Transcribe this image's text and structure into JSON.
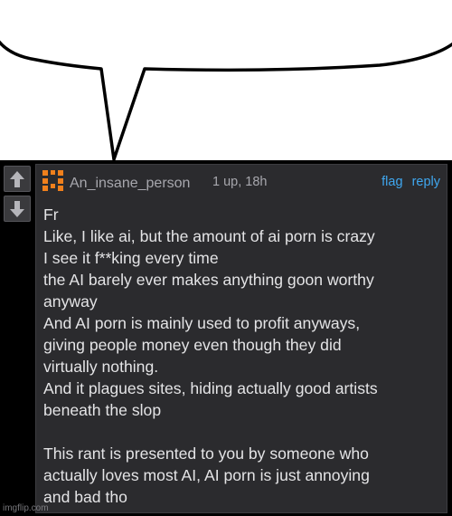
{
  "comment": {
    "username": "An_insane_person",
    "meta": "1 up, 18h",
    "actions": {
      "flag": "flag",
      "reply": "reply"
    },
    "lines": [
      "Fr",
      "Like, I like ai, but the amount of ai porn is crazy",
      "I see it f**king every time",
      "the AI barely ever makes anything goon worthy",
      "anyway",
      "And AI porn is mainly used to profit anyways,",
      "giving people money even though they did",
      "virtually nothing.",
      "And it plagues sites, hiding actually good artists",
      "beneath the slop",
      "",
      "This rant is presented to you by someone who",
      "actually loves most AI, AI porn is just annoying",
      "and bad tho"
    ]
  },
  "watermark": "imgflip.com",
  "colors": {
    "link": "#3fa7ef",
    "avatar": "#f0801c",
    "username": "#a7a7ad",
    "body_text": "#e4e4e6",
    "card_bg": "#2b2b2e"
  },
  "icons": {
    "upvote": "arrow-up-icon",
    "downvote": "arrow-down-icon",
    "avatar": "pixel-face-avatar"
  }
}
